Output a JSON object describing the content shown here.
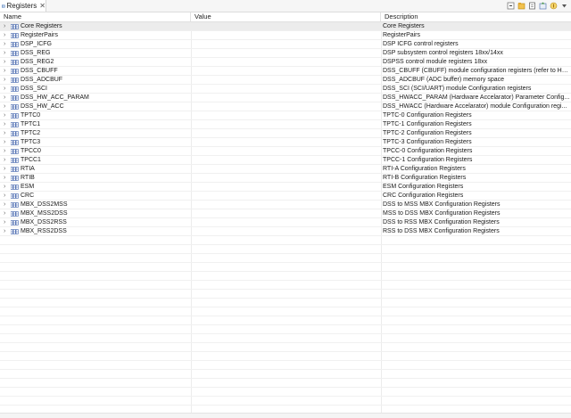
{
  "tab": {
    "label": "Registers",
    "close": "✕",
    "icon": "registers-icon"
  },
  "toolbar": {
    "buttons": [
      "collapse-all-icon",
      "load-group-icon",
      "new-group-icon",
      "export-icon",
      "import-icon",
      "view-menu-icon"
    ]
  },
  "columns": {
    "name": "Name",
    "value": "Value",
    "description": "Description"
  },
  "rows": [
    {
      "name": "Core Registers",
      "value": "",
      "description": "Core Registers"
    },
    {
      "name": "RegisterPairs",
      "value": "",
      "description": "RegisterPairs"
    },
    {
      "name": "DSP_ICFG",
      "value": "",
      "description": "DSP ICFG control registers"
    },
    {
      "name": "DSS_REG",
      "value": "",
      "description": "DSP subsystem control registers 18xx/14xx"
    },
    {
      "name": "DSS_REG2",
      "value": "",
      "description": "DSPSS control module registers 18xx"
    },
    {
      "name": "DSS_CBUFF",
      "value": "",
      "description": "DSS_CBUFF (CBUFF) module configuration registers (refer to HSI..."
    },
    {
      "name": "DSS_ADCBUF",
      "value": "",
      "description": "DSS_ADCBUF (ADC buffer) memory space"
    },
    {
      "name": "DSS_SCI",
      "value": "",
      "description": "DSS_SCI (SCI/UART) module Configuration registers"
    },
    {
      "name": "DSS_HW_ACC_PARAM",
      "value": "",
      "description": "DSS_HWACC_PARAM (Hardware Accelarator) Parameter Config..."
    },
    {
      "name": "DSS_HW_ACC",
      "value": "",
      "description": "DSS_HWACC (Hardware Accelarator) module Configuration regi..."
    },
    {
      "name": "TPTC0",
      "value": "",
      "description": "TPTC-0 Configuration Registers"
    },
    {
      "name": "TPTC1",
      "value": "",
      "description": "TPTC-1 Configuration Registers"
    },
    {
      "name": "TPTC2",
      "value": "",
      "description": "TPTC-2 Configuration Registers"
    },
    {
      "name": "TPTC3",
      "value": "",
      "description": "TPTC-3 Configuration Registers"
    },
    {
      "name": "TPCC0",
      "value": "",
      "description": "TPCC-0 Configuration Registers"
    },
    {
      "name": "TPCC1",
      "value": "",
      "description": "TPCC-1 Configuration Registers"
    },
    {
      "name": "RTIA",
      "value": "",
      "description": "RTI-A Configuration Registers"
    },
    {
      "name": "RTIB",
      "value": "",
      "description": "RTI-B Configuration Registers"
    },
    {
      "name": "ESM",
      "value": "",
      "description": "ESM Configuration Registers"
    },
    {
      "name": "CRC",
      "value": "",
      "description": "CRC Configuration Registers"
    },
    {
      "name": "MBX_DSS2MSS",
      "value": "",
      "description": "DSS to MSS MBX Configuration Registers"
    },
    {
      "name": "MBX_MSS2DSS",
      "value": "",
      "description": "MSS to DSS MBX Configuration Registers"
    },
    {
      "name": "MBX_DSS2RSS",
      "value": "",
      "description": "DSS to RSS MBX Configuration Registers"
    },
    {
      "name": "MBX_RSS2DSS",
      "value": "",
      "description": "RSS to DSS MBX Configuration Registers"
    }
  ],
  "selected_row": 0,
  "colors": {
    "selection": "#ececec",
    "icon_blue": "#3b5ea8",
    "grid": "#f0f0f0"
  }
}
